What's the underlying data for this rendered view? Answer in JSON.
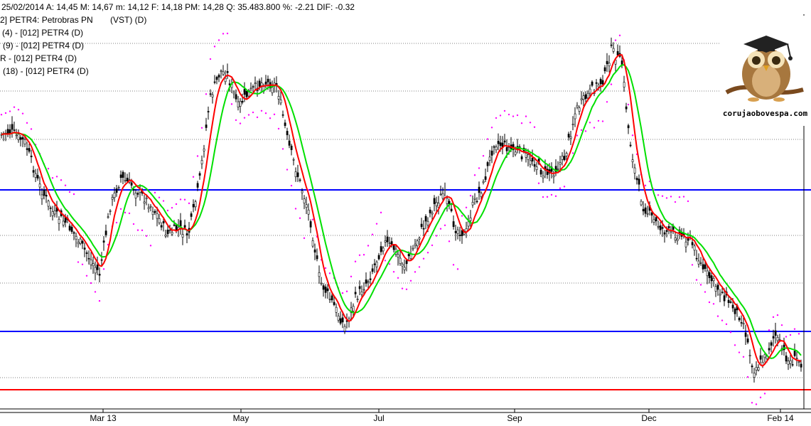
{
  "header": {
    "quote_line": "25/02/2014  A: 14,45   M: 14,67   m: 14,12   F: 14,18  PM: 14,28  Q: 35.483.800  %: -2.21 DIF: -0.32",
    "symbol_line": "2] PETR4: Petrobras PN",
    "vst_label": "(VST) (D)",
    "indicator_1": "(4)  - [012] PETR4 (D)",
    "indicator_2": "(9)  - [012] PETR4 (D)",
    "indicator_3": "R   - [012] PETR4 (D)",
    "indicator_4": "(18)  - [012] PETR4 (D)"
  },
  "logo": {
    "text": "corujaobovespa.com",
    "icon": "owl-graduate-icon"
  },
  "colors": {
    "background": "#ffffff",
    "candle": "#000000",
    "sma_fast": "#ff0000",
    "sma_slow": "#00e000",
    "sar": "#ff00ff",
    "support_line": "#0000ff",
    "bottom_line": "#ff0000",
    "grid": "#808080"
  },
  "chart_data": {
    "type": "candlestick",
    "title": "PETR4: Petrobras PN",
    "xaxis_labels": [
      "Mar 13",
      "May",
      "Jul",
      "Sep",
      "Dec",
      "Feb 14"
    ],
    "yaxis_visible": false,
    "grid": "horizontal dotted",
    "series": [
      {
        "name": "(4)",
        "kind": "moving-average"
      },
      {
        "name": "(9)",
        "kind": "moving-average"
      },
      {
        "name": "R",
        "kind": "parabolic-sar"
      },
      {
        "name": "(18)",
        "kind": "moving-average"
      }
    ],
    "horizontal_lines": [
      {
        "color": "#0000ff",
        "level": "upper support"
      },
      {
        "color": "#0000ff",
        "level": "lower support"
      },
      {
        "color": "#ff0000",
        "level": "bottom"
      }
    ]
  }
}
